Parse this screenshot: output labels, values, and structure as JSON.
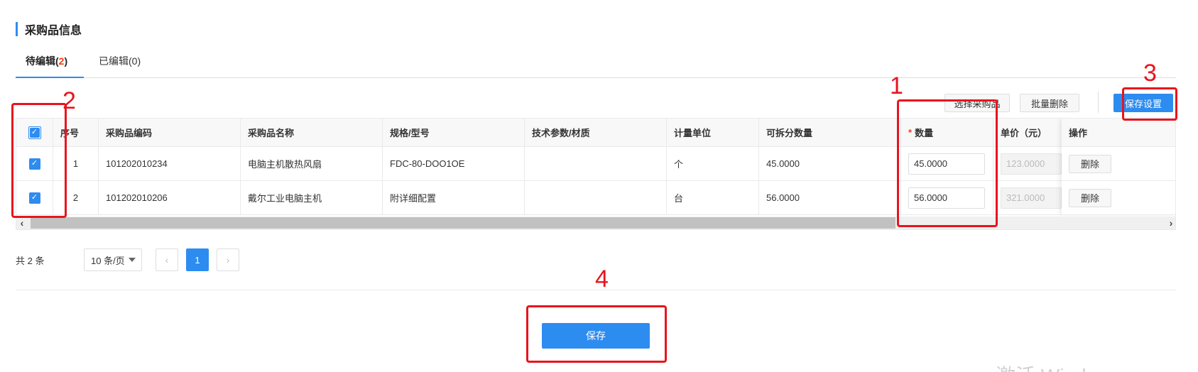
{
  "section": {
    "title": "采购品信息"
  },
  "tabs": [
    {
      "label_prefix": "待编辑(",
      "count": "2",
      "label_suffix": ")"
    },
    {
      "label": "已编辑(0)"
    }
  ],
  "toolbar": {
    "select_label": "选择采购品",
    "batch_delete_label": "批量删除",
    "save_settings_label": "保存设置"
  },
  "table": {
    "columns": {
      "seq": "序号",
      "code": "采购品编码",
      "name": "采购品名称",
      "spec": "规格/型号",
      "tech": "技术参数/材质",
      "unit": "计量单位",
      "splittable": "可拆分数量",
      "quantity_required": "*",
      "quantity": "数量",
      "price": "单价（元）",
      "action": "操作"
    },
    "rows": [
      {
        "seq": "1",
        "code": "101202010234",
        "name": "电脑主机散热风扇",
        "spec": "FDC-80-DOO1OE",
        "tech": "",
        "unit": "个",
        "splittable": "45.0000",
        "quantity": "45.0000",
        "price": "123.0000",
        "action": "删除"
      },
      {
        "seq": "2",
        "code": "101202010206",
        "name": "戴尔工业电脑主机",
        "spec": "附详细配置",
        "tech": "",
        "unit": "台",
        "splittable": "56.0000",
        "quantity": "56.0000",
        "price": "321.0000",
        "action": "删除"
      }
    ]
  },
  "pagination": {
    "total": "共 2 条",
    "page_size": "10 条/页",
    "prev": "‹",
    "current": "1",
    "next": "›"
  },
  "footer": {
    "save_label": "保存"
  },
  "annotations": [
    "1",
    "2",
    "3",
    "4"
  ],
  "watermark": "激活 Windows",
  "colors": {
    "primary": "#2d8cf0",
    "annotation": "#e8141d",
    "required": "#ed4014"
  }
}
